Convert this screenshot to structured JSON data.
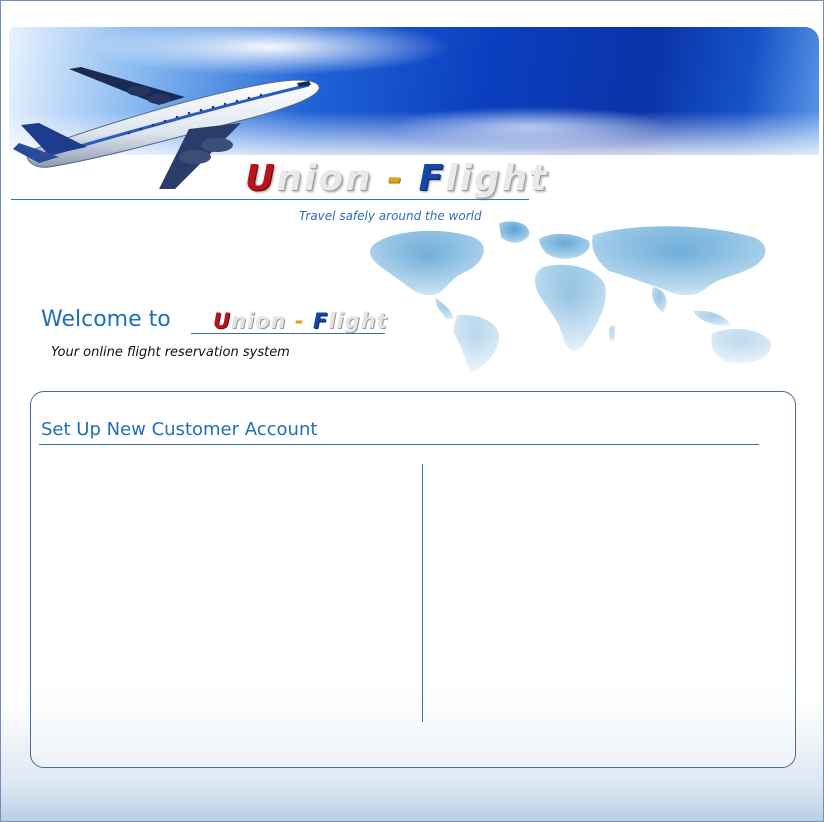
{
  "brand": {
    "logo_u": "U",
    "logo_nion": "nion",
    "logo_dash": "-",
    "logo_f": "F",
    "logo_light": "light",
    "tagline": "Travel  safely around the world"
  },
  "welcome": {
    "heading": "Welcome to",
    "subtitle": "Your online flight reservation system"
  },
  "form": {
    "title": "Set Up New Customer Account"
  },
  "colors": {
    "accent_blue": "#1f6fb8",
    "logo_red": "#b8141c",
    "logo_blue": "#1646a6",
    "banner_blue": "#0b3fbf"
  },
  "icons": {
    "banner_image": "airplane-icon",
    "map_image": "world-map-icon"
  }
}
